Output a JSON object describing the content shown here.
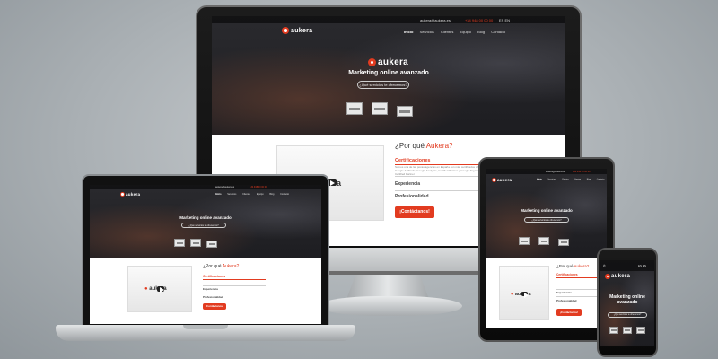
{
  "site": {
    "brand": "aukera",
    "email": "aukera@aukera.es",
    "phone": "+34 948 00 00 00",
    "lang": "ES EN",
    "nav": [
      "Inicio",
      "Servicios",
      "Clientes",
      "Equipo",
      "Blog",
      "Contacto"
    ],
    "hero_title": "Marketing online avanzado",
    "hero_button": "¿Qué servicios te ofrecemos?",
    "why_prefix": "¿Por qué ",
    "why_brand": "Aukera?",
    "accordion": [
      "Certificaciones",
      "Experiencia",
      "Profesionalidad"
    ],
    "cert_text": "Somos una de las pocas agencias en España con más certificados oficiales: Google AdWords, Google Analytics, Certified Partner y Google Tag Manager Certified Partner",
    "cta": "¡Contáctanos!"
  },
  "colors": {
    "accent": "#e23b20",
    "hero_dark": "#1d1d21"
  }
}
